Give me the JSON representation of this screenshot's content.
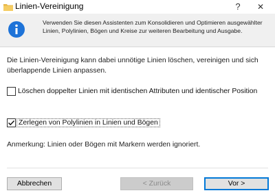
{
  "window": {
    "title": "Linien-Vereinigung",
    "help_label": "?",
    "close_label": "✕",
    "app_icon": "folder-icon"
  },
  "header": {
    "icon": "info-icon",
    "text": "Verwenden Sie diesen Assistenten zum Konsolidieren und Optimieren ausgewählter Linien, Polylinien, Bögen und Kreise zur weiteren Bearbeitung und Ausgabe."
  },
  "description": "Die Linien-Vereinigung kann dabei unnötige Linien löschen, vereinigen und sich überlappende Linien anpassen.",
  "options": {
    "delete_duplicates": {
      "label": "Löschen doppelter Linien mit identischen Attributen und identischer Position",
      "checked": false
    },
    "explode_polylines": {
      "label": "Zerlegen von Polylinien in Linien und Bögen",
      "checked": true
    }
  },
  "note": "Anmerkung: Linien oder Bögen mit Markern werden ignoriert.",
  "buttons": {
    "cancel": "Abbrechen",
    "back": "< Zurück",
    "next": "Vor >"
  },
  "colors": {
    "info_blue": "#1e73d8",
    "folder_yellow": "#e8b84a",
    "default_button_border": "#0078d7"
  }
}
